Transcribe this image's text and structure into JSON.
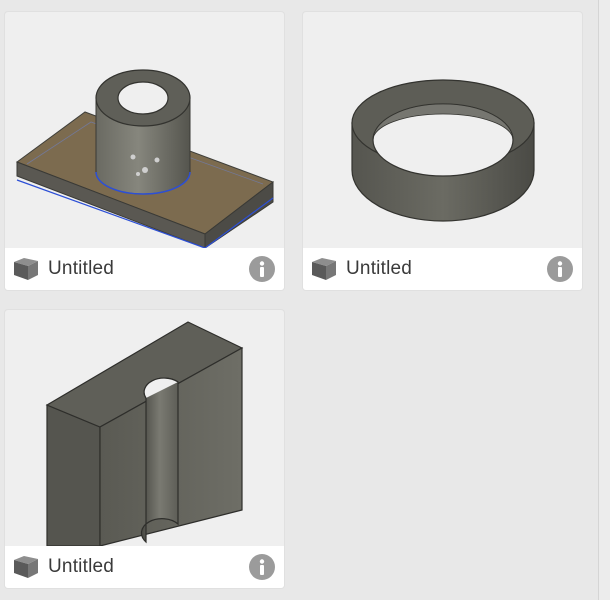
{
  "designs": [
    {
      "name": "Untitled",
      "thumbnail": "plate-with-cylinder-boss",
      "icon": "design-cube-icon",
      "info_icon": "info-icon"
    },
    {
      "name": "Untitled",
      "thumbnail": "ring",
      "icon": "design-cube-icon",
      "info_icon": "info-icon"
    },
    {
      "name": "Untitled",
      "thumbnail": "block-with-half-hole",
      "icon": "design-cube-icon",
      "info_icon": "info-icon"
    }
  ],
  "colors": {
    "background": "#e8e8e8",
    "card": "#efefef",
    "footer": "#ffffff",
    "model_gray": "#5d5d56",
    "plate_tan": "#7c6b4f",
    "selection_blue": "#2c4fd6",
    "info_gray": "#9b9b9b"
  }
}
